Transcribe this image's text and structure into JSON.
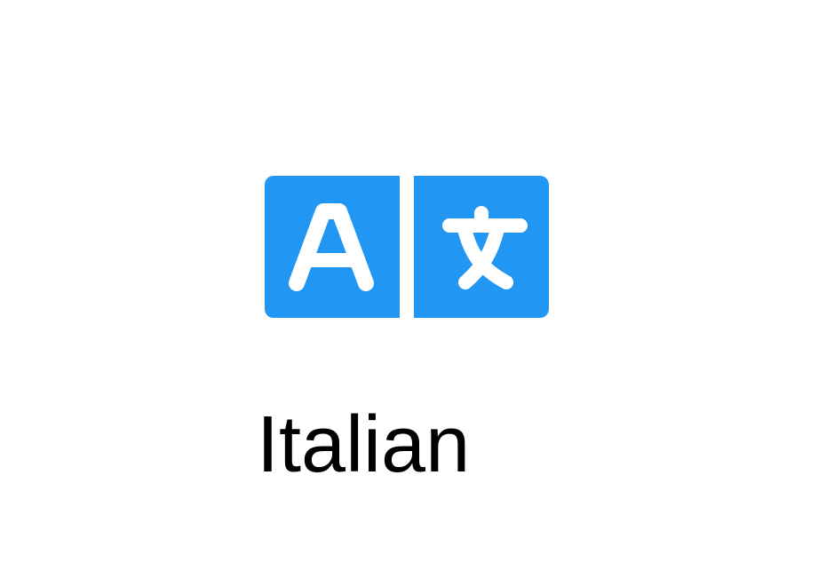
{
  "icon": {
    "name": "translate-icon",
    "color": "#2196F3",
    "left_glyph": "A",
    "right_glyph": "文"
  },
  "label": {
    "text": "Italian"
  }
}
